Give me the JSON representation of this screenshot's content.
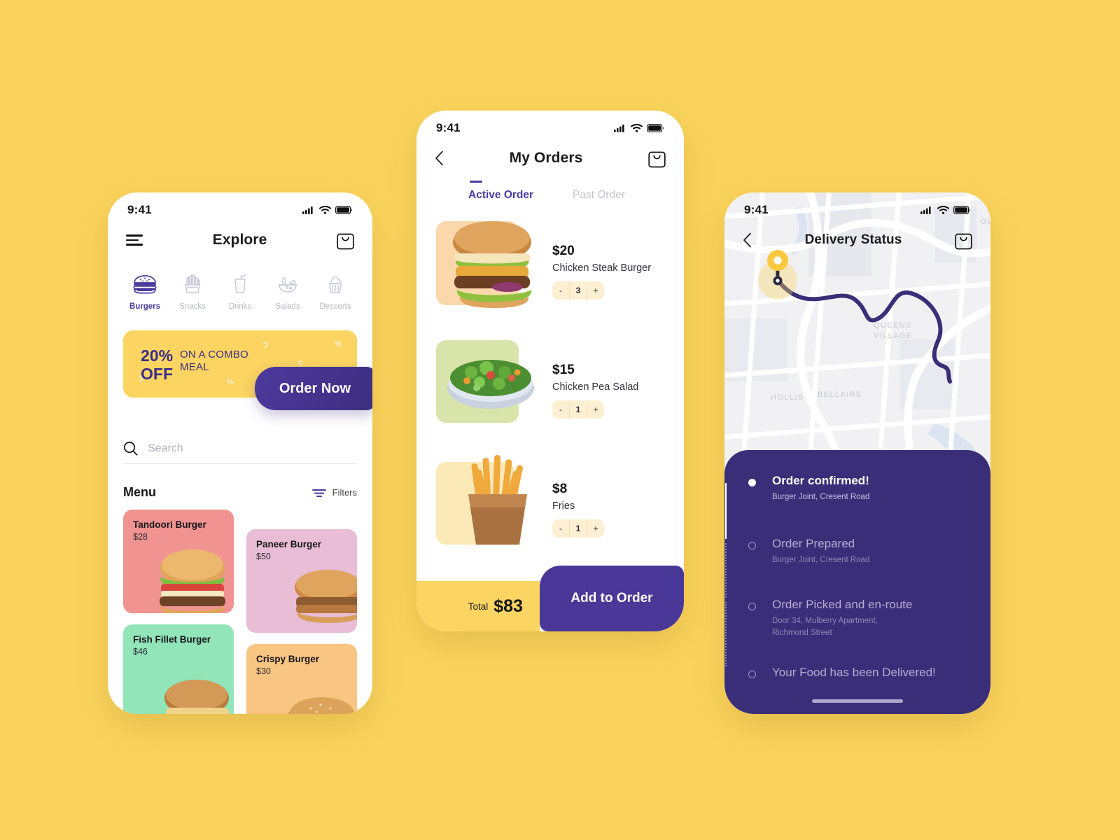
{
  "theme": {
    "background": "#FAD35C",
    "accent_purple": "#4A3899",
    "accent_yellow": "#FBD462"
  },
  "explore": {
    "status_bar": {
      "time": "9:41",
      "icons": [
        "signal-icon",
        "wifi-icon",
        "battery-icon"
      ]
    },
    "nav": {
      "menu_icon": "hamburger-icon",
      "title": "Explore",
      "bag_icon": "shopping-bag-icon"
    },
    "categories": [
      {
        "label": "Burgers",
        "icon": "burger-icon",
        "active": true
      },
      {
        "label": "Snacks",
        "icon": "fries-icon",
        "active": false
      },
      {
        "label": "Drinks",
        "icon": "drink-icon",
        "active": false
      },
      {
        "label": "Salads",
        "icon": "salad-icon",
        "active": false
      },
      {
        "label": "Desserts",
        "icon": "cupcake-icon",
        "active": false
      }
    ],
    "promo": {
      "percent": "20%",
      "off": "OFF",
      "line1": "ON A COMBO",
      "line2": "MEAL",
      "cta": "Order Now"
    },
    "search": {
      "placeholder": "Search",
      "value": "",
      "icon": "search-icon"
    },
    "menu": {
      "title": "Menu",
      "filters_label": "Filters",
      "filters_icon": "filter-icon"
    },
    "items": [
      {
        "name": "Tandoori Burger",
        "price": "$28",
        "color": "#F09391"
      },
      {
        "name": "Paneer Burger",
        "price": "$50",
        "color": "#E9BDD6"
      },
      {
        "name": "Fish Fillet Burger",
        "price": "$46",
        "color": "#92E4B9"
      },
      {
        "name": "Crispy Burger",
        "price": "$30",
        "color": "#F9C583"
      }
    ]
  },
  "orders": {
    "status_bar": {
      "time": "9:41"
    },
    "nav": {
      "back_icon": "chevron-left-icon",
      "title": "My Orders",
      "bag_icon": "shopping-bag-icon"
    },
    "tabs": [
      {
        "label": "Active Order",
        "active": true
      },
      {
        "label": "Past Order",
        "active": false
      }
    ],
    "items": [
      {
        "price": "$20",
        "name": "Chicken Steak Burger",
        "qty": "3",
        "minus": "-",
        "plus": "+",
        "thumb_color": "#FAD8AC"
      },
      {
        "price": "$15",
        "name": "Chicken Pea Salad",
        "qty": "1",
        "minus": "-",
        "plus": "+",
        "thumb_color": "#D8E4AA"
      },
      {
        "price": "$8",
        "name": "Fries",
        "qty": "1",
        "minus": "-",
        "plus": "+",
        "thumb_color": "#FCE9B8"
      }
    ],
    "footer": {
      "total_label": "Total",
      "total_value": "$83",
      "cta": "Add to Order"
    }
  },
  "tracking": {
    "status_bar": {
      "time": "9:41"
    },
    "nav": {
      "back_icon": "chevron-left-icon",
      "title": "Delivery Status",
      "bag_icon": "shopping-bag-icon"
    },
    "map": {
      "labels": [
        "QUEENS VILLAGE",
        "BELLAIRE",
        "HOLLIS",
        "GLEN"
      ],
      "pin_icon": "location-pin-icon"
    },
    "steps": [
      {
        "title": "Order confirmed!",
        "sub": "Burger Joint, Cresent Road",
        "done": true
      },
      {
        "title": "Order Prepared",
        "sub": "Burger Joint, Cresent Road",
        "done": false
      },
      {
        "title": "Order Picked and en-route",
        "sub": "Door 34, Mulberry Apartment,\nRichmond Street",
        "done": false
      },
      {
        "title": "Your Food has been Delivered!",
        "sub": "",
        "done": false
      }
    ]
  }
}
